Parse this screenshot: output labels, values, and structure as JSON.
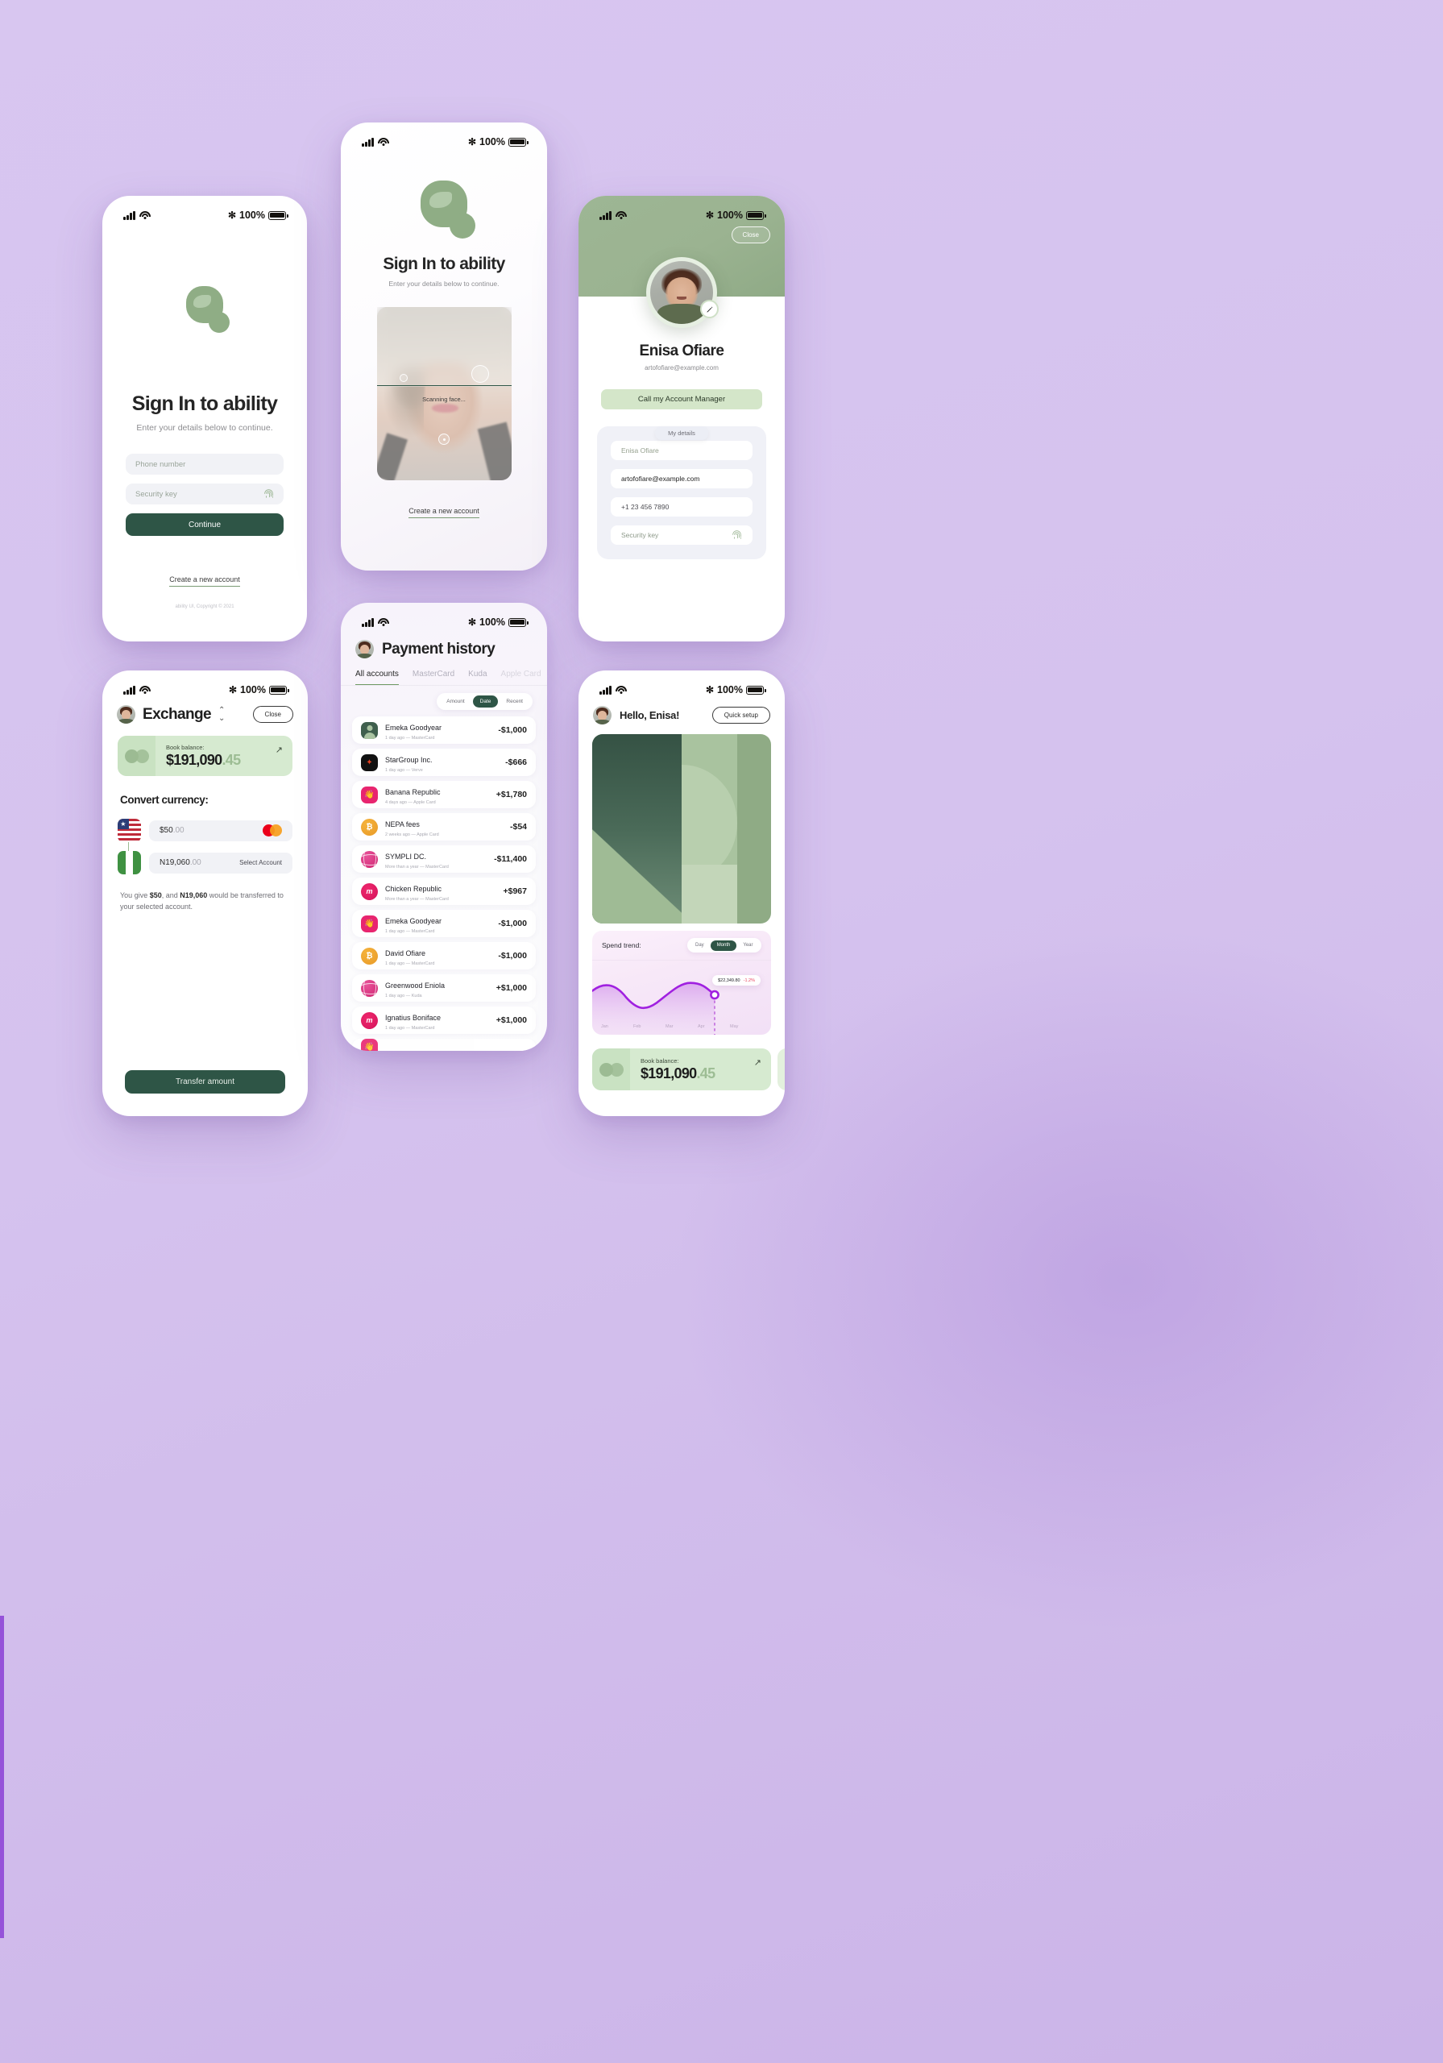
{
  "app": {
    "name": "ability",
    "accent_green": "#2e5546",
    "soft_green": "#d6ead0",
    "background": "#d5c2ee"
  },
  "status_bar": {
    "battery_text": "100%"
  },
  "signin": {
    "title": "Sign In to ability",
    "subtitle": "Enter your details below to continue.",
    "phone_placeholder": "Phone number",
    "security_placeholder": "Security key",
    "continue_label": "Continue",
    "create_account_label": "Create a new account",
    "copyright": "ability UI, Copyright © 2021"
  },
  "face": {
    "title": "Sign In to ability",
    "subtitle": "Enter your details below to continue.",
    "scanning_label": "Scanning face...",
    "create_account_label": "Create a new account"
  },
  "profile": {
    "close_label": "Close",
    "name": "Enisa Ofiare",
    "email": "artofofiare@example.com",
    "call_manager_label": "Call my Account Manager",
    "details_tab_label": "My details",
    "fields": [
      {
        "value": "Enisa Ofiare",
        "muted": true
      },
      {
        "value": "artofofiare@example.com",
        "muted": false
      },
      {
        "value": "+1 23 456 7890",
        "muted": true
      },
      {
        "value": "Security key",
        "muted": true
      }
    ]
  },
  "exchange": {
    "title": "Exchange",
    "close_label": "Close",
    "balance_label": "Book balance:",
    "balance_main": "$191,090",
    "balance_cents": ".45",
    "convert_heading": "Convert currency:",
    "from_value": "$50",
    "from_decimals": ".00",
    "to_value": "N19,060",
    "to_decimals": ".00",
    "select_account_label": "Select Account",
    "note_prefix": "You give ",
    "note_give": "$50",
    "note_mid": ", and ",
    "note_receive": "N19,060",
    "note_suffix": " would be transferred to your selected account.",
    "transfer_label": "Transfer amount"
  },
  "history": {
    "title": "Payment history",
    "tabs": [
      "All accounts",
      "MasterCard",
      "Kuda",
      "Apple Card"
    ],
    "active_tab": "All accounts",
    "sort_options": [
      "Amount",
      "Date",
      "Recent"
    ],
    "sort_active": "Date",
    "transactions": [
      {
        "name": "Emeka Goodyear",
        "meta": "1 day ago — MasterCard",
        "amount": "-$1,000",
        "icon": "person"
      },
      {
        "name": "StarGroup Inc.",
        "meta": "1 day ago — Verve",
        "amount": "-$666",
        "icon": "star"
      },
      {
        "name": "Banana Republic",
        "meta": "4 days ago — Apple Card",
        "amount": "+$1,780",
        "icon": "wave"
      },
      {
        "name": "NEPA fees",
        "meta": "2 weeks ago — Apple Card",
        "amount": "-$54",
        "icon": "bitcoin"
      },
      {
        "name": "SYMPLI DC.",
        "meta": "More than a year — MasterCard",
        "amount": "-$11,400",
        "icon": "dribbble"
      },
      {
        "name": "Chicken Republic",
        "meta": "More than a year — MasterCard",
        "amount": "+$967",
        "icon": "m"
      },
      {
        "name": "Emeka Goodyear",
        "meta": "1 day ago — MasterCard",
        "amount": "-$1,000",
        "icon": "wave"
      },
      {
        "name": "David Ofiare",
        "meta": "1 day ago — MasterCard",
        "amount": "-$1,000",
        "icon": "bitcoin"
      },
      {
        "name": "Greenwood Eniola",
        "meta": "1 day ago — Kuda",
        "amount": "+$1,000",
        "icon": "dribbble"
      },
      {
        "name": "Ignatius Boniface",
        "meta": "1 day ago — MasterCard",
        "amount": "+$1,000",
        "icon": "m"
      }
    ]
  },
  "home": {
    "greeting": "Hello, Enisa!",
    "quick_setup_label": "Quick setup",
    "balance_label": "Book balance:",
    "balance_main": "$191,090",
    "balance_cents": ".45"
  },
  "chart_data": {
    "type": "area",
    "title": "Spend trend:",
    "range_options": [
      "Day",
      "Month",
      "Year"
    ],
    "range_active": "Month",
    "categories": [
      "Jan",
      "Feb",
      "Mar",
      "Apr",
      "May"
    ],
    "values": [
      62,
      41,
      78,
      66,
      58
    ],
    "tooltip_value": "$22,349.80",
    "tooltip_change": "-1.2%",
    "highlight_category": "Apr",
    "line_color": "#a020e0",
    "grid": false,
    "xlabel": "",
    "ylabel": ""
  }
}
